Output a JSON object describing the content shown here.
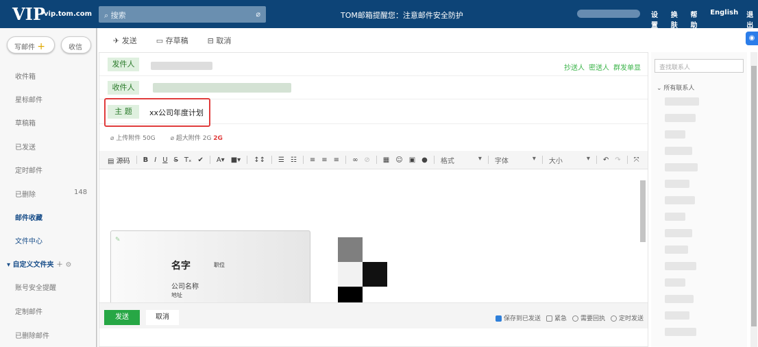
{
  "header": {
    "logo": "VIP",
    "domain": "vip.tom.com",
    "search_placeholder": "搜索",
    "notice": "TOM邮箱提醒您：注意邮件安全防护",
    "nav": [
      "设置",
      "换肤",
      "帮助",
      "English",
      "退出"
    ]
  },
  "sidebar": {
    "compose": "写邮件",
    "receive": "收信",
    "items": [
      {
        "label": "收件箱"
      },
      {
        "label": "星标邮件"
      },
      {
        "label": "草稿箱"
      },
      {
        "label": "已发送"
      },
      {
        "label": "定时邮件"
      },
      {
        "label": "已删除",
        "count": "148"
      },
      {
        "label": "邮件收藏"
      },
      {
        "label": "文件中心"
      }
    ],
    "folder_group": "自定义文件夹",
    "folders": [
      "账号安全提醒",
      "定制邮件",
      "已删除邮件"
    ]
  },
  "toolbar": {
    "send": "发送",
    "draft": "存草稿",
    "cancel": "取消"
  },
  "compose": {
    "from_label": "发件人",
    "to_label": "收件人",
    "subject_label": "主 题",
    "subject_value": "xx公司年度计划",
    "cc": "抄送人",
    "bcc": "密送人",
    "group": "群发单显",
    "attach": "上传附件 50G",
    "big_attach": "超大附件 2G",
    "big_badge": "2G"
  },
  "editor": {
    "source": "源码",
    "format": "格式",
    "font": "字体",
    "size": "大小"
  },
  "signature": {
    "name": "名字",
    "title": "职位",
    "company": "公司名称",
    "address": "地址"
  },
  "footer": {
    "send": "发送",
    "cancel": "取消",
    "save_sent": "保存到已发送",
    "urgent": "紧急",
    "receipt": "需要回执",
    "scheduled": "定时发送"
  },
  "contacts": {
    "search_placeholder": "查找联系人",
    "group": "所有联系人"
  }
}
